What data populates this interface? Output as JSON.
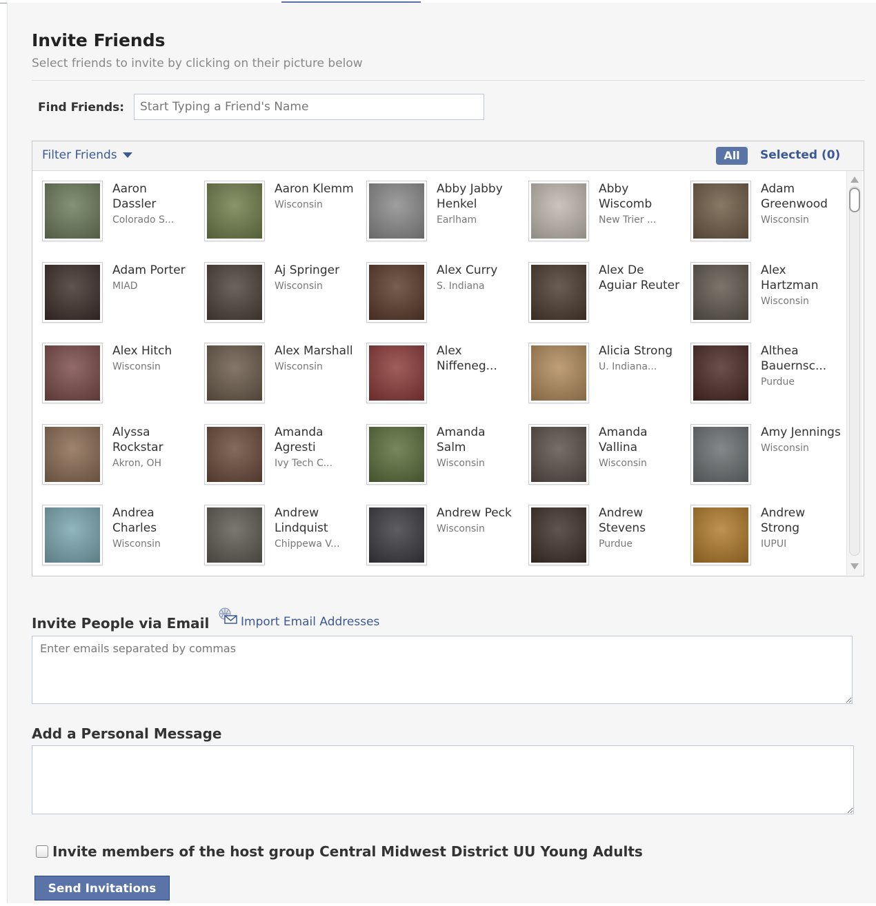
{
  "header": {
    "title": "Invite Friends",
    "subtitle": "Select friends to invite by clicking on their picture below"
  },
  "find": {
    "label": "Find Friends:",
    "placeholder": "Start Typing a Friend's Name"
  },
  "filter_bar": {
    "filter_label": "Filter Friends",
    "all_label": "All",
    "selected_label": "Selected (0)"
  },
  "friends": [
    {
      "name": "Aaron Dassler",
      "network": "Colorado S...",
      "color": "#6b7a5a"
    },
    {
      "name": "Aaron Klemm",
      "network": "Wisconsin",
      "color": "#6f7d4a"
    },
    {
      "name": "Abby Jabby Henkel",
      "network": "Earlham",
      "color": "#8a8a8a"
    },
    {
      "name": "Abby Wiscomb",
      "network": "New Trier ...",
      "color": "#bfb8ae"
    },
    {
      "name": "Adam Greenwood",
      "network": "Wisconsin",
      "color": "#6e5a44"
    },
    {
      "name": "Adam Porter",
      "network": "MIAD",
      "color": "#3d2e28"
    },
    {
      "name": "Aj Springer",
      "network": "Wisconsin",
      "color": "#4a4238"
    },
    {
      "name": "Alex Curry",
      "network": "S. Indiana",
      "color": "#5a3a2a"
    },
    {
      "name": "Alex De Aguiar Reuter",
      "network": "",
      "color": "#4a3a2e"
    },
    {
      "name": "Alex Hartzman",
      "network": "Wisconsin",
      "color": "#5e574c"
    },
    {
      "name": "Alex Hitch",
      "network": "Wisconsin",
      "color": "#7a4a48"
    },
    {
      "name": "Alex Marshall",
      "network": "Wisconsin",
      "color": "#6a5a4a"
    },
    {
      "name": "Alex Niffeneg...",
      "network": "",
      "color": "#8a3a38"
    },
    {
      "name": "Alicia Strong",
      "network": "U. Indiana...",
      "color": "#b08a5a"
    },
    {
      "name": "Althea Bauernsc...",
      "network": "Purdue",
      "color": "#4a2a26"
    },
    {
      "name": "Alyssa Rockstar",
      "network": "Akron, OH",
      "color": "#8a6a50"
    },
    {
      "name": "Amanda Agresti",
      "network": "Ivy Tech C...",
      "color": "#6a4a3a"
    },
    {
      "name": "Amanda Salm",
      "network": "Wisconsin",
      "color": "#5a6e3a"
    },
    {
      "name": "Amanda Vallina",
      "network": "Wisconsin",
      "color": "#5a4e48"
    },
    {
      "name": "Amy Jennings",
      "network": "Wisconsin",
      "color": "#6a6e70"
    },
    {
      "name": "Andrea Charles",
      "network": "Wisconsin",
      "color": "#7aa6b0"
    },
    {
      "name": "Andrew Lindquist",
      "network": "Chippewa V...",
      "color": "#5e5a52"
    },
    {
      "name": "Andrew Peck",
      "network": "Wisconsin",
      "color": "#3a3a40"
    },
    {
      "name": "Andrew Stevens",
      "network": "Purdue",
      "color": "#3e3028"
    },
    {
      "name": "Andrew Strong",
      "network": "IUPUI",
      "color": "#b07a2a"
    }
  ],
  "email": {
    "heading": "Invite People via Email",
    "import_label": "Import Email Addresses",
    "placeholder": "Enter emails separated by commas"
  },
  "message": {
    "heading": "Add a Personal Message"
  },
  "host_group": {
    "label": "Invite members of the host group Central Midwest District UU Young Adults"
  },
  "submit": {
    "label": "Send Invitations"
  }
}
